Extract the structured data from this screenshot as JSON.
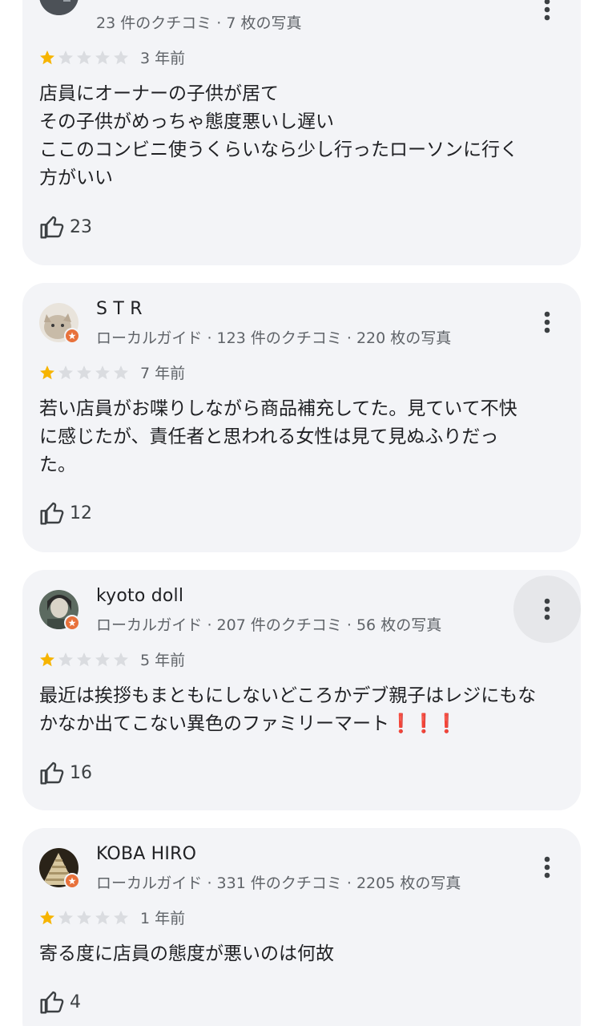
{
  "reviews": [
    {
      "name": "",
      "meta": "23 件のクチコミ · 7 枚の写真",
      "rating": 1,
      "time": "3 年前",
      "text": "店員にオーナーの子供が居て\nその子供がめっちゃ態度悪いし遅い\nここのコンビニ使うくらいなら少し行ったローソンに行く\n方がいい",
      "likes": "23"
    },
    {
      "name": "S T R",
      "meta": "ローカルガイド · 123 件のクチコミ · 220 枚の写真",
      "rating": 1,
      "time": "7 年前",
      "text": "若い店員がお喋りしながら商品補充してた。見ていて不快\nに感じたが、責任者と思われる女性は見て見ぬふりだっ\nた。",
      "likes": "12"
    },
    {
      "name": "kyoto doll",
      "meta": "ローカルガイド · 207 件のクチコミ · 56 枚の写真",
      "rating": 1,
      "time": "5 年前",
      "text": "最近は挨拶もまともにしないどころかデブ親子はレジにもな\nかなか出てこない異色のファミリーマート",
      "emphasis": "❗❗❗",
      "likes": "16"
    },
    {
      "name": "KOBA HIRO",
      "meta": "ローカルガイド · 331 件のクチコミ · 2205 枚の写真",
      "rating": 1,
      "time": "1 年前",
      "text": "寄る度に店員の態度が悪いのは何故",
      "likes": "4"
    }
  ],
  "icons": {
    "more": "more-vert-icon",
    "like": "thumbs-up-icon",
    "badge": "local-guide-badge-icon",
    "star": "star-icon"
  },
  "colors": {
    "card_bg": "#f3f4f7",
    "star_filled": "#f6b400",
    "star_empty": "#dadce0",
    "badge": "#e8713b",
    "secondary_text": "#5f6368"
  }
}
